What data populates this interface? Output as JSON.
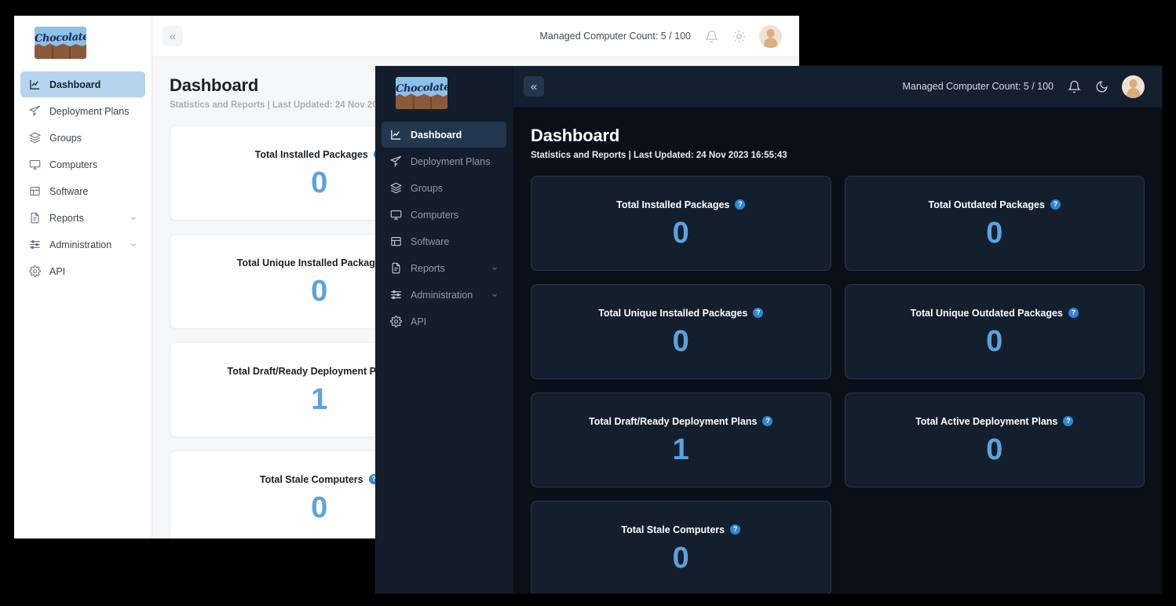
{
  "brand": {
    "logo_text": "Chocolatey",
    "logo_name": "chocolatey-logo"
  },
  "sidebar": {
    "items": [
      {
        "label": "Dashboard",
        "icon": "chart-line-icon",
        "active": true,
        "expandable": false
      },
      {
        "label": "Deployment Plans",
        "icon": "paper-plane-icon",
        "active": false,
        "expandable": false
      },
      {
        "label": "Groups",
        "icon": "layers-icon",
        "active": false,
        "expandable": false
      },
      {
        "label": "Computers",
        "icon": "monitor-icon",
        "active": false,
        "expandable": false
      },
      {
        "label": "Software",
        "icon": "grid-icon",
        "active": false,
        "expandable": false
      },
      {
        "label": "Reports",
        "icon": "document-icon",
        "active": false,
        "expandable": true
      },
      {
        "label": "Administration",
        "icon": "sliders-icon",
        "active": false,
        "expandable": true
      },
      {
        "label": "API",
        "icon": "gear-icon",
        "active": false,
        "expandable": false
      }
    ]
  },
  "topbar": {
    "collapse_glyph": "«",
    "collapse_name": "collapse-sidebar-button",
    "managed_count": "Managed Computer Count: 5 / 100",
    "bell_icon": "bell-icon",
    "theme_icon_light": "sun-icon",
    "theme_icon_dark": "moon-icon",
    "avatar_name": "user-avatar"
  },
  "page": {
    "title": "Dashboard",
    "subtitle": "Statistics and Reports | Last Updated: 24 Nov 2023 16:55:43",
    "help_glyph": "?"
  },
  "cards": [
    {
      "title": "Total Installed Packages",
      "value": "0"
    },
    {
      "title": "Total Outdated Packages",
      "value": "0"
    },
    {
      "title": "Total Unique Installed Packages",
      "value": "0"
    },
    {
      "title": "Total Unique Outdated Packages",
      "value": "0"
    },
    {
      "title": "Total Draft/Ready Deployment Plans",
      "value": "1"
    },
    {
      "title": "Total Active Deployment Plans",
      "value": "0"
    },
    {
      "title": "Total Stale Computers",
      "value": "0"
    }
  ],
  "colors": {
    "accent_blue": "#5ca3dd",
    "help_blue": "#2f86d6",
    "light_sidebar_active": "#b7d4ee",
    "dark_sidebar_active": "#23384f",
    "dark_card_bg": "#141f2e",
    "dark_page_bg": "#0a1018",
    "light_page_bg": "#f6f7f9"
  }
}
